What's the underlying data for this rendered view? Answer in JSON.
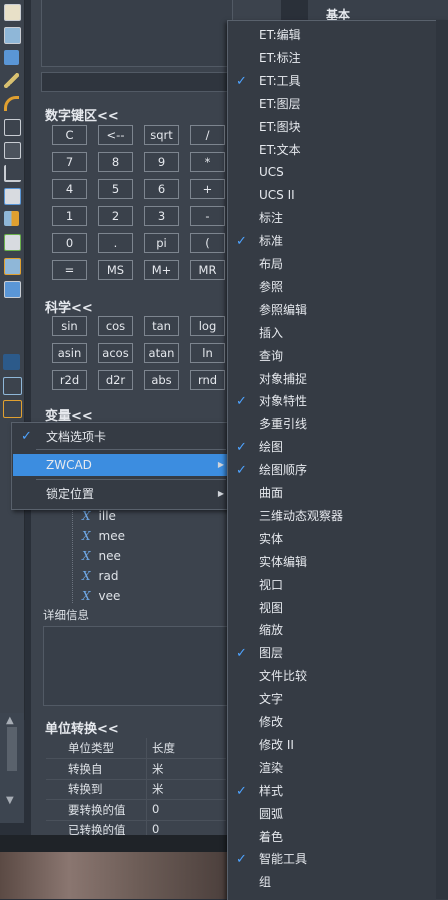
{
  "side_panel": {
    "title": "基本"
  },
  "numpad": {
    "title": "数字键区<<",
    "keys": [
      "C",
      "<--",
      "sqrt",
      "/",
      "7",
      "8",
      "9",
      "*",
      "4",
      "5",
      "6",
      "+",
      "1",
      "2",
      "3",
      "-",
      "0",
      ".",
      "pi",
      "(",
      "=",
      "MS",
      "M+",
      "MR"
    ]
  },
  "scientific": {
    "title": "科学<<",
    "keys": [
      "sin",
      "cos",
      "tan",
      "log",
      "asin",
      "acos",
      "atan",
      "ln",
      "r2d",
      "d2r",
      "abs",
      "rnd"
    ]
  },
  "variables": {
    "title": "变量<<",
    "items": [
      "ille",
      "mee",
      "nee",
      "rad",
      "vee"
    ]
  },
  "details": {
    "label": "详细信息"
  },
  "unit_conversion": {
    "title": "单位转换<<",
    "rows": [
      {
        "label": "单位类型",
        "value": "长度"
      },
      {
        "label": "转换自",
        "value": "米"
      },
      {
        "label": "转换到",
        "value": "米"
      },
      {
        "label": "要转换的值",
        "value": "0"
      },
      {
        "label": "已转换的值",
        "value": "0"
      }
    ]
  },
  "context_menu": {
    "items": [
      {
        "label": "文档选项卡",
        "checked": true,
        "submenu": false,
        "highlighted": false
      },
      {
        "label": "ZWCAD",
        "checked": false,
        "submenu": true,
        "highlighted": true
      },
      {
        "label": "锁定位置",
        "checked": false,
        "submenu": true,
        "highlighted": false
      }
    ],
    "check_glyph": "✓",
    "submenu_glyph": "▶"
  },
  "toolbar_menu": {
    "items": [
      {
        "label": "ET:编辑",
        "checked": false
      },
      {
        "label": "ET:标注",
        "checked": false
      },
      {
        "label": "ET:工具",
        "checked": true
      },
      {
        "label": "ET:图层",
        "checked": false
      },
      {
        "label": "ET:图块",
        "checked": false
      },
      {
        "label": "ET:文本",
        "checked": false
      },
      {
        "label": "UCS",
        "checked": false
      },
      {
        "label": "UCS II",
        "checked": false
      },
      {
        "label": "标注",
        "checked": false
      },
      {
        "label": "标准",
        "checked": true
      },
      {
        "label": "布局",
        "checked": false
      },
      {
        "label": "参照",
        "checked": false
      },
      {
        "label": "参照编辑",
        "checked": false
      },
      {
        "label": "插入",
        "checked": false
      },
      {
        "label": "查询",
        "checked": false
      },
      {
        "label": "对象捕捉",
        "checked": false
      },
      {
        "label": "对象特性",
        "checked": true
      },
      {
        "label": "多重引线",
        "checked": false
      },
      {
        "label": "绘图",
        "checked": true
      },
      {
        "label": "绘图顺序",
        "checked": true
      },
      {
        "label": "曲面",
        "checked": false
      },
      {
        "label": "三维动态观察器",
        "checked": false
      },
      {
        "label": "实体",
        "checked": false
      },
      {
        "label": "实体编辑",
        "checked": false
      },
      {
        "label": "视口",
        "checked": false
      },
      {
        "label": "视图",
        "checked": false
      },
      {
        "label": "缩放",
        "checked": false
      },
      {
        "label": "图层",
        "checked": true
      },
      {
        "label": "文件比较",
        "checked": false
      },
      {
        "label": "文字",
        "checked": false
      },
      {
        "label": "修改",
        "checked": false
      },
      {
        "label": "修改 II",
        "checked": false
      },
      {
        "label": "渲染",
        "checked": false
      },
      {
        "label": "样式",
        "checked": true
      },
      {
        "label": "圆弧",
        "checked": false
      },
      {
        "label": "着色",
        "checked": false
      },
      {
        "label": "智能工具",
        "checked": true
      },
      {
        "label": "组",
        "checked": false
      }
    ]
  },
  "colors": {
    "accent": "#3c8de0",
    "check": "#4ea3ff",
    "panel": "#3c434d",
    "menu": "#353b44"
  },
  "icons": [
    "document-icon",
    "grid-icon",
    "pen-icon",
    "ruler-icon",
    "arc-icon",
    "nodes-icon",
    "copy-icon",
    "chart-icon",
    "doc-edit-icon",
    "grid-pen-icon",
    "form-icon",
    "grid-x-icon",
    "layers-icon",
    "stack-icon",
    "swap-icon",
    "scroll-up-icon",
    "scroll-down-icon",
    "x-variable-icon"
  ]
}
